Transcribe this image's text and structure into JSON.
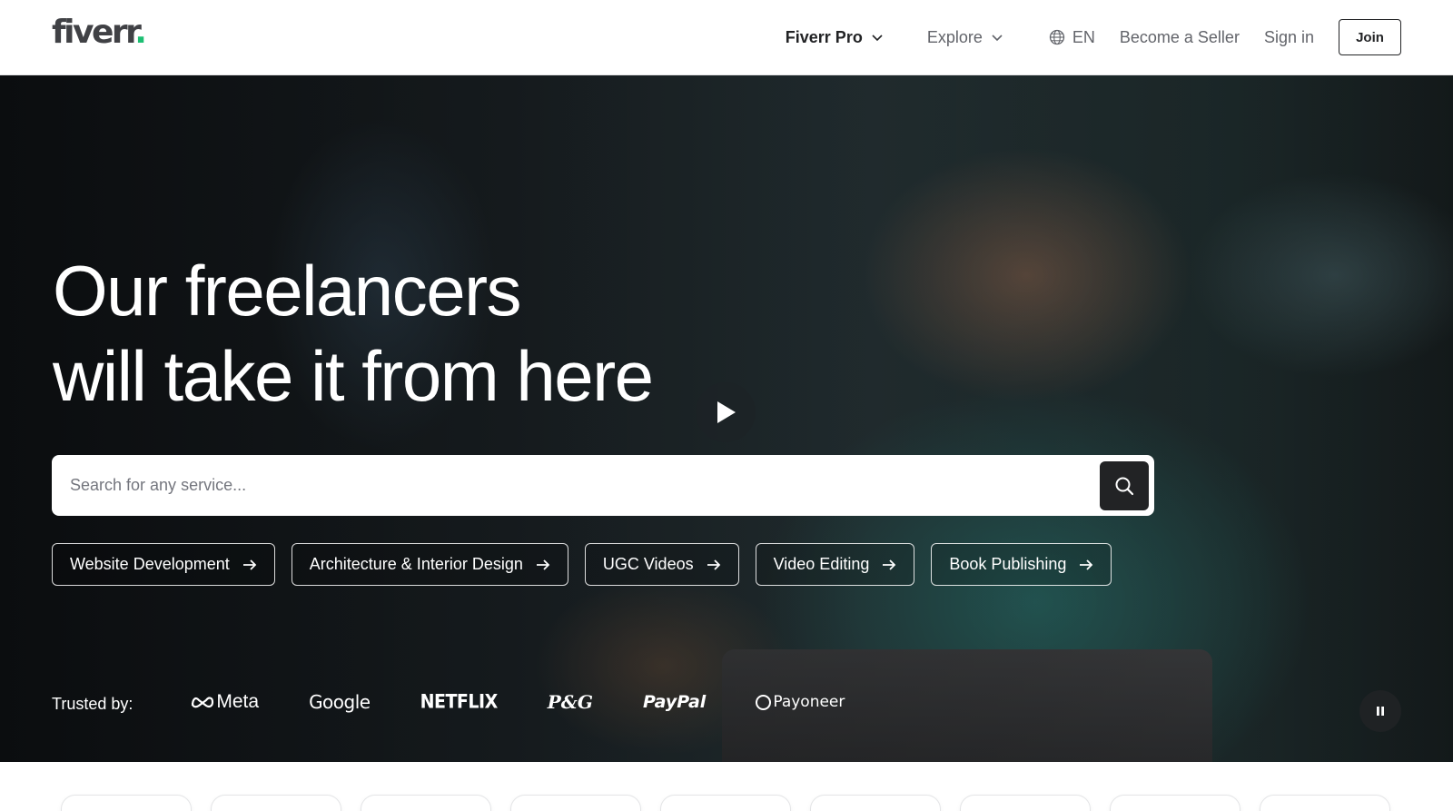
{
  "header": {
    "logo_text": "fiverr",
    "logo_dot": ".",
    "nav": {
      "fiverr_pro": "Fiverr Pro",
      "explore": "Explore",
      "language": "EN",
      "become_seller": "Become a Seller",
      "sign_in": "Sign in",
      "join": "Join"
    }
  },
  "hero": {
    "title_line1": "Our freelancers",
    "title_line2": "will take it from here",
    "search": {
      "placeholder": "Search for any service..."
    },
    "chips": [
      "Website Development",
      "Architecture & Interior Design",
      "UGC Videos",
      "Video Editing",
      "Book Publishing"
    ],
    "trusted_label": "Trusted by:",
    "brands": [
      "Meta",
      "Google",
      "NETFLIX",
      "P&G",
      "PayPal",
      "Payoneer"
    ]
  },
  "colors": {
    "brand_green": "#1dbf73",
    "text_dark": "#222325",
    "text_gray": "#62646a"
  },
  "icons": [
    "chevron-down-icon",
    "globe-icon",
    "play-icon",
    "search-icon",
    "arrow-right-icon",
    "pause-icon",
    "meta-logo-icon"
  ]
}
